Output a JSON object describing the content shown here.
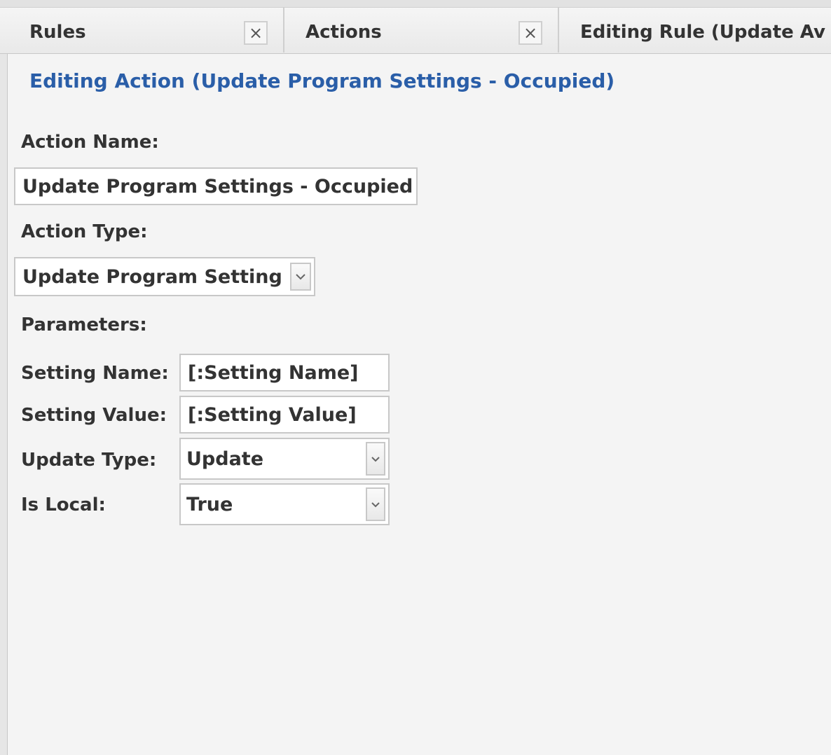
{
  "tabs": [
    {
      "label": "Rules",
      "close": "×"
    },
    {
      "label": "Actions",
      "close": "×"
    },
    {
      "label": "Editing Rule (Update Av"
    }
  ],
  "subtab": {
    "label": "Editing Action (Update Program Settings - Occupied)"
  },
  "form": {
    "action_name_label": "Action Name:",
    "action_name_value": "Update Program Settings - Occupied",
    "action_type_label": "Action Type:",
    "action_type_value": "Update Program Setting",
    "parameters_label": "Parameters:",
    "setting_name_label": "Setting Name:",
    "setting_name_value": "[:Setting Name]",
    "setting_value_label": "Setting Value:",
    "setting_value_value": "[:Setting Value]",
    "update_type_label": "Update Type:",
    "update_type_value": "Update",
    "is_local_label": "Is Local:",
    "is_local_value": "True"
  },
  "icons": {
    "close": "close-icon",
    "dropdown": "chevron-down-icon"
  },
  "colors": {
    "accent": "#2a5ea8",
    "border": "#c8c8c8",
    "background": "#f4f4f4"
  }
}
